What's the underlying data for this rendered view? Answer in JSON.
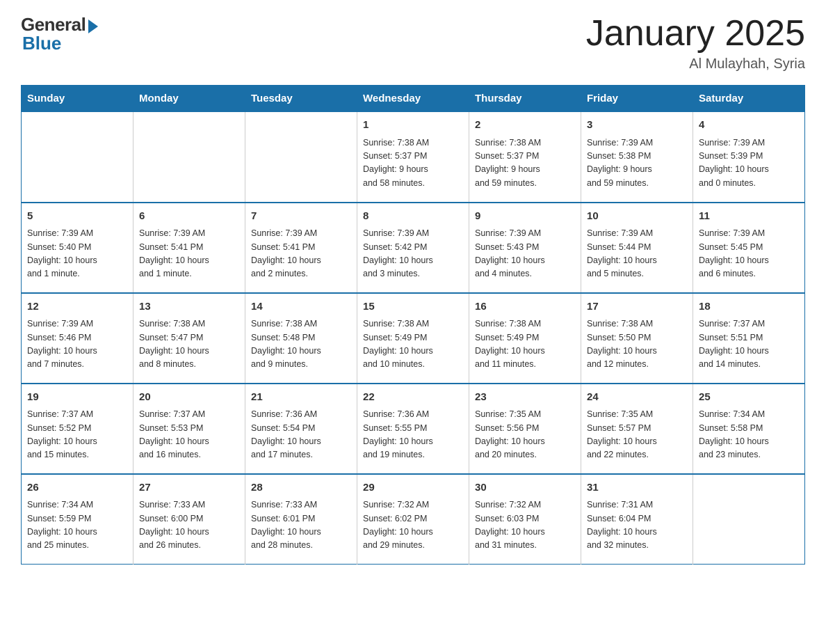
{
  "header": {
    "logo_general": "General",
    "logo_blue": "Blue",
    "title": "January 2025",
    "subtitle": "Al Mulayhah, Syria"
  },
  "columns": [
    "Sunday",
    "Monday",
    "Tuesday",
    "Wednesday",
    "Thursday",
    "Friday",
    "Saturday"
  ],
  "weeks": [
    [
      {
        "day": "",
        "info": ""
      },
      {
        "day": "",
        "info": ""
      },
      {
        "day": "",
        "info": ""
      },
      {
        "day": "1",
        "info": "Sunrise: 7:38 AM\nSunset: 5:37 PM\nDaylight: 9 hours\nand 58 minutes."
      },
      {
        "day": "2",
        "info": "Sunrise: 7:38 AM\nSunset: 5:37 PM\nDaylight: 9 hours\nand 59 minutes."
      },
      {
        "day": "3",
        "info": "Sunrise: 7:39 AM\nSunset: 5:38 PM\nDaylight: 9 hours\nand 59 minutes."
      },
      {
        "day": "4",
        "info": "Sunrise: 7:39 AM\nSunset: 5:39 PM\nDaylight: 10 hours\nand 0 minutes."
      }
    ],
    [
      {
        "day": "5",
        "info": "Sunrise: 7:39 AM\nSunset: 5:40 PM\nDaylight: 10 hours\nand 1 minute."
      },
      {
        "day": "6",
        "info": "Sunrise: 7:39 AM\nSunset: 5:41 PM\nDaylight: 10 hours\nand 1 minute."
      },
      {
        "day": "7",
        "info": "Sunrise: 7:39 AM\nSunset: 5:41 PM\nDaylight: 10 hours\nand 2 minutes."
      },
      {
        "day": "8",
        "info": "Sunrise: 7:39 AM\nSunset: 5:42 PM\nDaylight: 10 hours\nand 3 minutes."
      },
      {
        "day": "9",
        "info": "Sunrise: 7:39 AM\nSunset: 5:43 PM\nDaylight: 10 hours\nand 4 minutes."
      },
      {
        "day": "10",
        "info": "Sunrise: 7:39 AM\nSunset: 5:44 PM\nDaylight: 10 hours\nand 5 minutes."
      },
      {
        "day": "11",
        "info": "Sunrise: 7:39 AM\nSunset: 5:45 PM\nDaylight: 10 hours\nand 6 minutes."
      }
    ],
    [
      {
        "day": "12",
        "info": "Sunrise: 7:39 AM\nSunset: 5:46 PM\nDaylight: 10 hours\nand 7 minutes."
      },
      {
        "day": "13",
        "info": "Sunrise: 7:38 AM\nSunset: 5:47 PM\nDaylight: 10 hours\nand 8 minutes."
      },
      {
        "day": "14",
        "info": "Sunrise: 7:38 AM\nSunset: 5:48 PM\nDaylight: 10 hours\nand 9 minutes."
      },
      {
        "day": "15",
        "info": "Sunrise: 7:38 AM\nSunset: 5:49 PM\nDaylight: 10 hours\nand 10 minutes."
      },
      {
        "day": "16",
        "info": "Sunrise: 7:38 AM\nSunset: 5:49 PM\nDaylight: 10 hours\nand 11 minutes."
      },
      {
        "day": "17",
        "info": "Sunrise: 7:38 AM\nSunset: 5:50 PM\nDaylight: 10 hours\nand 12 minutes."
      },
      {
        "day": "18",
        "info": "Sunrise: 7:37 AM\nSunset: 5:51 PM\nDaylight: 10 hours\nand 14 minutes."
      }
    ],
    [
      {
        "day": "19",
        "info": "Sunrise: 7:37 AM\nSunset: 5:52 PM\nDaylight: 10 hours\nand 15 minutes."
      },
      {
        "day": "20",
        "info": "Sunrise: 7:37 AM\nSunset: 5:53 PM\nDaylight: 10 hours\nand 16 minutes."
      },
      {
        "day": "21",
        "info": "Sunrise: 7:36 AM\nSunset: 5:54 PM\nDaylight: 10 hours\nand 17 minutes."
      },
      {
        "day": "22",
        "info": "Sunrise: 7:36 AM\nSunset: 5:55 PM\nDaylight: 10 hours\nand 19 minutes."
      },
      {
        "day": "23",
        "info": "Sunrise: 7:35 AM\nSunset: 5:56 PM\nDaylight: 10 hours\nand 20 minutes."
      },
      {
        "day": "24",
        "info": "Sunrise: 7:35 AM\nSunset: 5:57 PM\nDaylight: 10 hours\nand 22 minutes."
      },
      {
        "day": "25",
        "info": "Sunrise: 7:34 AM\nSunset: 5:58 PM\nDaylight: 10 hours\nand 23 minutes."
      }
    ],
    [
      {
        "day": "26",
        "info": "Sunrise: 7:34 AM\nSunset: 5:59 PM\nDaylight: 10 hours\nand 25 minutes."
      },
      {
        "day": "27",
        "info": "Sunrise: 7:33 AM\nSunset: 6:00 PM\nDaylight: 10 hours\nand 26 minutes."
      },
      {
        "day": "28",
        "info": "Sunrise: 7:33 AM\nSunset: 6:01 PM\nDaylight: 10 hours\nand 28 minutes."
      },
      {
        "day": "29",
        "info": "Sunrise: 7:32 AM\nSunset: 6:02 PM\nDaylight: 10 hours\nand 29 minutes."
      },
      {
        "day": "30",
        "info": "Sunrise: 7:32 AM\nSunset: 6:03 PM\nDaylight: 10 hours\nand 31 minutes."
      },
      {
        "day": "31",
        "info": "Sunrise: 7:31 AM\nSunset: 6:04 PM\nDaylight: 10 hours\nand 32 minutes."
      },
      {
        "day": "",
        "info": ""
      }
    ]
  ]
}
